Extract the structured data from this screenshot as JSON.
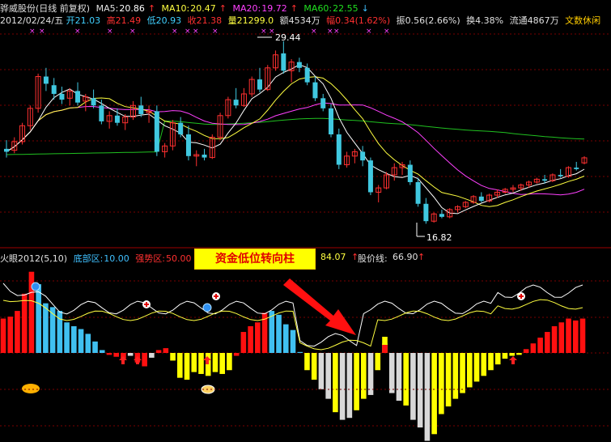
{
  "header": {
    "name": "骅威股份(日线 前复权)",
    "ma5_label": "MA5:",
    "ma5_value": "20.86",
    "ma10_label": "MA10:",
    "ma10_value": "20.47",
    "ma20_label": "MA20:",
    "ma20_value": "19.72",
    "ma60_label": "MA60:",
    "ma60_value": "22.55"
  },
  "quote": {
    "date": "2012/02/24/五",
    "open": "开21.03",
    "high": "高21.49",
    "low": "低20.93",
    "close": "收21.38",
    "volume": "量21299.0",
    "amount": "额4534万",
    "change": "幅0.34(1.62%)",
    "amplitude": "振0.56(2.66%)",
    "turnover": "换4.38%",
    "float": "流通4867万",
    "brand": "文数休闲"
  },
  "annotations": {
    "high": "29.44",
    "low": "16.82"
  },
  "indicator": {
    "name": "火眼2012(5,10)",
    "bottom_label": "底部区:",
    "bottom_value": "10.00",
    "strong_label": "强势区:",
    "strong_value": "50.00",
    "v3": "84.07",
    "price_label": "股价线:",
    "price_value": "66.90"
  },
  "banner_text": "资金低位转向柱",
  "colors": {
    "up": "#ff3030",
    "down": "#40c8e0",
    "ma5": "#ffffff",
    "ma10": "#ffff40",
    "ma20": "#ff40ff",
    "ma60": "#20c020",
    "grid": "#7a0000",
    "yellow": "#ffff00",
    "gray": "#d8d8d8",
    "cyan": "#40c0f0",
    "red": "#ff1010"
  },
  "chart_data": [
    {
      "type": "candlestick",
      "candles": [
        [
          22.0,
          22.6,
          21.4,
          21.8
        ],
        [
          21.9,
          22.8,
          21.7,
          22.5
        ],
        [
          22.5,
          23.8,
          22.3,
          23.6
        ],
        [
          23.6,
          25.0,
          23.3,
          24.8
        ],
        [
          24.8,
          27.2,
          24.5,
          27.0
        ],
        [
          27.0,
          27.6,
          26.0,
          26.5
        ],
        [
          26.4,
          26.9,
          25.4,
          25.8
        ],
        [
          25.8,
          26.3,
          25.1,
          25.4
        ],
        [
          25.5,
          26.2,
          25.0,
          26.0
        ],
        [
          26.0,
          26.6,
          25.0,
          25.2
        ],
        [
          25.3,
          25.8,
          24.6,
          25.6
        ],
        [
          25.5,
          26.1,
          24.8,
          25.0
        ],
        [
          25.0,
          25.4,
          23.7,
          23.9
        ],
        [
          23.9,
          24.6,
          23.4,
          24.3
        ],
        [
          24.3,
          24.8,
          23.6,
          23.8
        ],
        [
          23.8,
          24.4,
          23.3,
          24.2
        ],
        [
          24.2,
          25.3,
          24.0,
          25.0
        ],
        [
          25.0,
          25.6,
          24.2,
          24.4
        ],
        [
          24.5,
          25.0,
          23.8,
          24.6
        ],
        [
          24.6,
          25.0,
          21.5,
          21.8
        ],
        [
          21.8,
          22.4,
          21.4,
          22.2
        ],
        [
          22.2,
          24.0,
          21.9,
          23.8
        ],
        [
          23.8,
          24.2,
          22.8,
          23.0
        ],
        [
          23.0,
          23.6,
          21.2,
          21.5
        ],
        [
          21.5,
          21.9,
          20.8,
          21.6
        ],
        [
          21.6,
          22.0,
          21.2,
          21.4
        ],
        [
          21.4,
          23.0,
          21.3,
          22.8
        ],
        [
          22.8,
          24.5,
          22.6,
          24.3
        ],
        [
          24.3,
          25.6,
          24.1,
          25.4
        ],
        [
          25.4,
          26.2,
          24.8,
          25.0
        ],
        [
          25.0,
          26.2,
          24.9,
          25.8
        ],
        [
          25.8,
          27.0,
          25.6,
          26.8
        ],
        [
          26.8,
          27.6,
          25.9,
          26.1
        ],
        [
          26.1,
          27.8,
          26.0,
          27.6
        ],
        [
          27.6,
          28.8,
          27.4,
          28.5
        ],
        [
          28.6,
          29.44,
          27.2,
          27.4
        ],
        [
          27.4,
          28.2,
          26.6,
          28.0
        ],
        [
          28.0,
          28.3,
          27.3,
          27.6
        ],
        [
          27.6,
          27.9,
          26.4,
          26.6
        ],
        [
          26.6,
          27.0,
          25.3,
          25.5
        ],
        [
          25.5,
          25.8,
          24.6,
          24.8
        ],
        [
          24.8,
          25.1,
          22.8,
          23.0
        ],
        [
          23.0,
          23.4,
          20.6,
          20.9
        ],
        [
          20.9,
          21.8,
          20.7,
          21.5
        ],
        [
          21.5,
          22.0,
          21.0,
          21.8
        ],
        [
          21.8,
          22.2,
          20.8,
          21.2
        ],
        [
          21.2,
          21.4,
          18.8,
          19.0
        ],
        [
          19.0,
          19.5,
          18.3,
          19.3
        ],
        [
          19.3,
          20.4,
          19.2,
          20.2
        ],
        [
          20.2,
          21.0,
          19.8,
          20.7
        ],
        [
          20.7,
          21.1,
          20.2,
          20.9
        ],
        [
          20.9,
          21.2,
          19.5,
          19.7
        ],
        [
          19.7,
          20.0,
          18.0,
          18.2
        ],
        [
          18.2,
          18.6,
          16.82,
          17.0
        ],
        [
          17.0,
          17.6,
          16.9,
          17.5
        ],
        [
          17.5,
          17.8,
          17.2,
          17.3
        ],
        [
          17.3,
          17.9,
          17.2,
          17.8
        ],
        [
          17.8,
          18.1,
          17.6,
          18.0
        ],
        [
          18.0,
          18.4,
          17.9,
          18.3
        ],
        [
          18.3,
          18.8,
          18.2,
          18.7
        ],
        [
          18.7,
          19.0,
          18.3,
          18.4
        ],
        [
          18.4,
          18.9,
          18.3,
          18.8
        ],
        [
          18.8,
          19.2,
          18.6,
          19.0
        ],
        [
          19.0,
          19.3,
          18.9,
          19.2
        ],
        [
          19.2,
          19.5,
          19.0,
          19.3
        ],
        [
          19.3,
          19.6,
          19.1,
          19.5
        ],
        [
          19.5,
          19.8,
          19.3,
          19.7
        ],
        [
          19.7,
          20.0,
          19.6,
          19.9
        ],
        [
          19.9,
          20.2,
          19.6,
          19.8
        ],
        [
          19.8,
          20.3,
          19.7,
          20.2
        ],
        [
          20.2,
          20.6,
          20.0,
          20.1
        ],
        [
          20.1,
          20.8,
          20.0,
          20.7
        ],
        [
          20.7,
          21.1,
          20.5,
          20.6
        ],
        [
          21.03,
          21.49,
          20.93,
          21.38
        ]
      ],
      "ylim": [
        15.5,
        30.5
      ]
    },
    {
      "type": "bar",
      "values": [
        36,
        38,
        44,
        62,
        85,
        72,
        52,
        48,
        44,
        32,
        28,
        25,
        20,
        12,
        3,
        -2,
        -4,
        -6,
        -3,
        -10,
        -14,
        -5,
        3,
        5,
        -8,
        -26,
        -28,
        -20,
        -22,
        -24,
        -20,
        -22,
        -18,
        -3,
        22,
        28,
        32,
        42,
        44,
        40,
        30,
        24,
        1,
        -18,
        -28,
        -38,
        -48,
        -62,
        -70,
        -68,
        -60,
        -48,
        -44,
        -18,
        10,
        -42,
        -50,
        -55,
        -70,
        -78,
        -92,
        -85,
        -64,
        -56,
        -48,
        -42,
        -36,
        -30,
        -24,
        -18,
        -12,
        -6,
        -3,
        -2,
        4,
        10,
        16,
        22,
        28,
        32,
        36,
        34,
        36
      ],
      "colors": [
        "r",
        "r",
        "r",
        "r",
        "r",
        "c",
        "c",
        "c",
        "c",
        "c",
        "c",
        "c",
        "c",
        "c",
        "c",
        "r",
        "r",
        "r",
        "g",
        "r",
        "r",
        "g",
        "r",
        "r",
        "y",
        "y",
        "y",
        "y",
        "y",
        "y",
        "y",
        "y",
        "y",
        "r",
        "r",
        "r",
        "r",
        "r",
        "c",
        "c",
        "c",
        "c",
        "c",
        "y",
        "y",
        "g",
        "g",
        "y",
        "g",
        "g",
        "y",
        "y",
        "g",
        "y",
        "y",
        "g",
        "g",
        "y",
        "g",
        "g",
        "g",
        "y",
        "y",
        "y",
        "y",
        "y",
        "y",
        "y",
        "y",
        "y",
        "y",
        "y",
        "y",
        "y",
        "r",
        "r",
        "r",
        "r",
        "r",
        "r",
        "r",
        "r",
        "r"
      ],
      "yellow_signal_index": 54,
      "ylim": [
        -100,
        100
      ]
    }
  ]
}
